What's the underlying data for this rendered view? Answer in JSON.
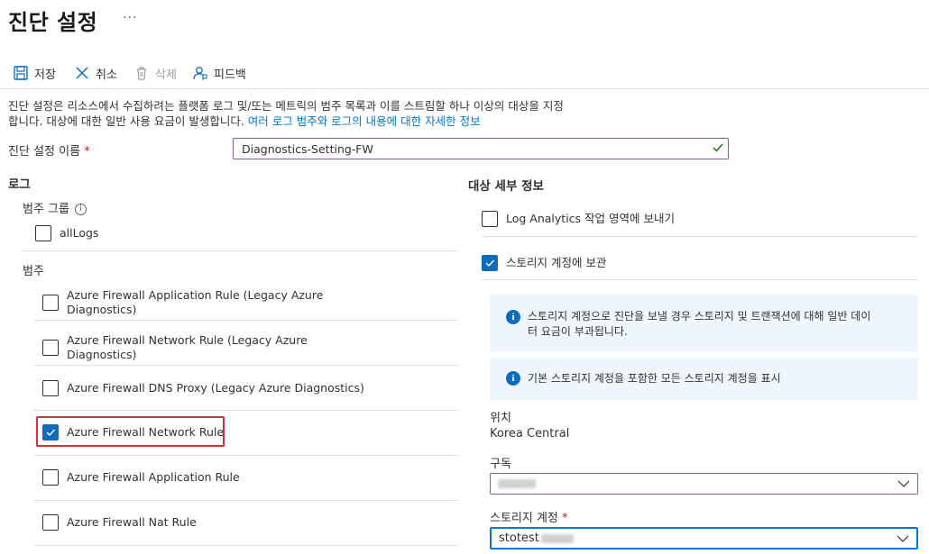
{
  "header": {
    "title": "진단 설정",
    "more": "···"
  },
  "toolbar": {
    "save": "저장",
    "cancel": "취소",
    "delete": "삭제",
    "feedback": "피드백"
  },
  "description": {
    "line1": "진단 설정은 리소스에서 수집하려는 플랫폼 로그 및/또는 메트릭의 범주 목록과 이를 스트림할 하나 이상의 대상을 지정",
    "line2": "합니다. 대상에 대한 일반 사용 요금이 발생합니다. ",
    "link": "여러 로그 범주와 로그의 내용에 대한 자세한 정보"
  },
  "setting_name": {
    "label": "진단 설정 이름",
    "required": "*",
    "value": "Diagnostics-Setting-FW"
  },
  "logs": {
    "heading": "로그",
    "category_groups_label": "범주 그룹",
    "info_icon": "i",
    "all_logs": {
      "label": "allLogs",
      "checked": false
    },
    "categories_label": "범주",
    "categories": [
      {
        "line1": "Azure Firewall Application Rule (Legacy Azure",
        "line2": "Diagnostics)",
        "checked": false
      },
      {
        "line1": "Azure Firewall Network Rule (Legacy Azure",
        "line2": "Diagnostics)",
        "checked": false
      },
      {
        "line1": "Azure Firewall DNS Proxy (Legacy Azure Diagnostics)",
        "line2": "",
        "checked": false
      },
      {
        "line1": "Azure Firewall Network Rule",
        "line2": "",
        "checked": true
      },
      {
        "line1": "Azure Firewall Application Rule",
        "line2": "",
        "checked": false
      },
      {
        "line1": "Azure Firewall Nat Rule",
        "line2": "",
        "checked": false
      }
    ]
  },
  "destination": {
    "heading": "대상 세부 정보",
    "log_analytics": {
      "label": "Log Analytics 작업 영역에 보내기",
      "checked": false
    },
    "storage": {
      "label": "스토리지 계정에 보관",
      "checked": true
    },
    "info1": {
      "icon": "i",
      "line1": "스토리지 계정으로 진단을 보낼 경우 스토리지 및 트랜잭션에 대해 일반 데이",
      "line2": "터 요금이 부과됩니다."
    },
    "info2": {
      "icon": "i",
      "text": "기본 스토리지 계정을 포함한 모든 스토리지 계정을 표시"
    },
    "location_label": "위치",
    "location_value": "Korea Central",
    "subscription_label": "구독",
    "storage_account_label": "스토리지 계정",
    "storage_account_required": "*",
    "storage_account_value": "stotest"
  },
  "colors": {
    "accent": "#0f6cbd",
    "link": "#0078d4",
    "highlight": "#d13438",
    "info_bg": "#eff6fc",
    "input_border": "#8a5aa8",
    "valid_check": "#107c10"
  }
}
